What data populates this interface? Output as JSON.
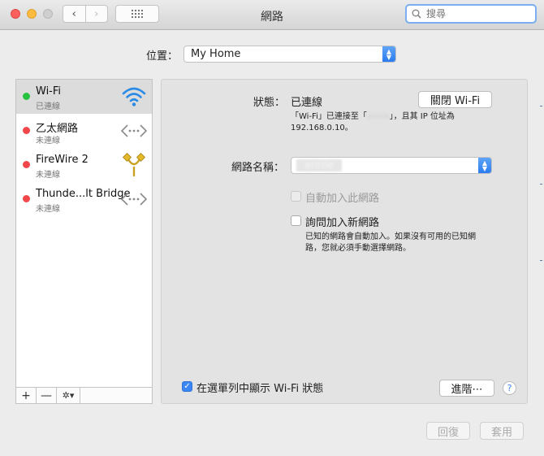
{
  "window": {
    "title": "網路"
  },
  "toolbar": {
    "back_icon": "‹",
    "forward_icon": "›",
    "grid_icon": "⋮⋮⋮",
    "search_placeholder": "搜尋"
  },
  "location": {
    "label": "位置：",
    "value": "My Home"
  },
  "services": [
    {
      "name": "Wi-Fi",
      "status": "已連線",
      "status_color": "#29c240",
      "icon": "wifi-icon",
      "selected": true
    },
    {
      "name": "乙太網路",
      "status": "未連線",
      "status_color": "#f2474a",
      "icon": "ethernet-icon"
    },
    {
      "name": "FireWire 2",
      "status": "未連線",
      "status_color": "#f2474a",
      "icon": "firewire-icon"
    },
    {
      "name": "Thunde...lt Bridge",
      "status": "未連線",
      "status_color": "#f2474a",
      "icon": "thunderbolt-bridge-icon"
    }
  ],
  "sidebar_tools": {
    "add": "+",
    "remove": "—",
    "gear": "✲▾"
  },
  "detail": {
    "status_label": "狀態：",
    "status_value": "已連線",
    "turn_off_button": "關閉 Wi-Fi",
    "status_desc_1": "「Wi-Fi」已連接至「",
    "status_desc_blur": "annie",
    "status_desc_2": "」，且其 IP 位址為",
    "status_desc_3": "192.168.0.10。",
    "network_name_label": "網路名稱：",
    "network_name_value": "annie",
    "auto_join_label": "自動加入此網路",
    "ask_join_label": "詢問加入新網路",
    "ask_join_desc_1": "已知的網路會自動加入。如果沒有可用的已知網",
    "ask_join_desc_2": "路，您就必須手動選擇網路。",
    "show_menubar_label": "在選單列中顯示 Wi-Fi 狀態",
    "advanced_button": "進階⋯",
    "help_icon": "?"
  },
  "footer": {
    "revert_button": "回復",
    "apply_button": "套用"
  },
  "colors": {
    "accent": "#3a86f2",
    "wifi_blue": "#2a8be6",
    "connected": "#29c240",
    "disconnected": "#f2474a"
  }
}
